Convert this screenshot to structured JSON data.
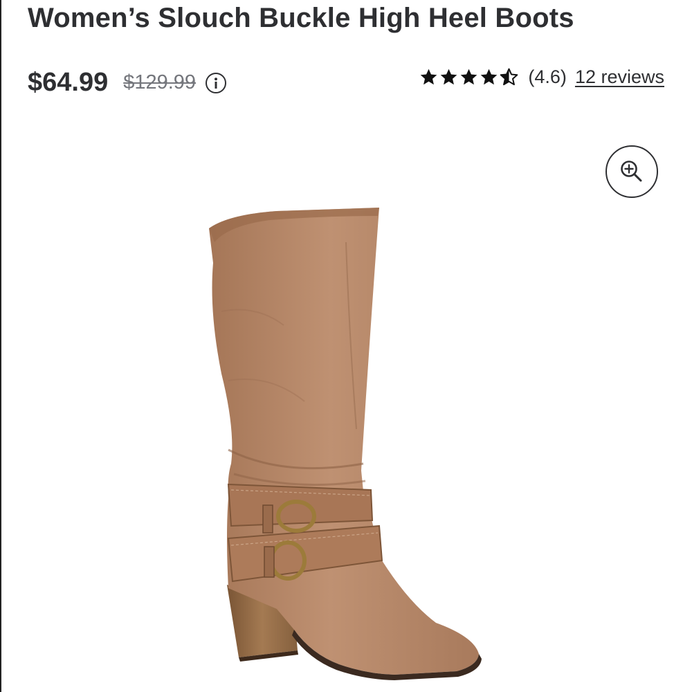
{
  "product": {
    "title": "Women’s Slouch Buckle High Heel Boots",
    "price_current": "$64.99",
    "price_was": "$129.99"
  },
  "rating": {
    "stars": 4.6,
    "value_text": "(4.6)",
    "reviews_text": "12 reviews"
  },
  "icons": {
    "info": "info-icon",
    "zoom": "zoom-in-icon",
    "star": "star-icon"
  },
  "colors": {
    "text": "#2e2f32",
    "strike_price": "#74767c",
    "boot_leather": "#b5876a"
  }
}
